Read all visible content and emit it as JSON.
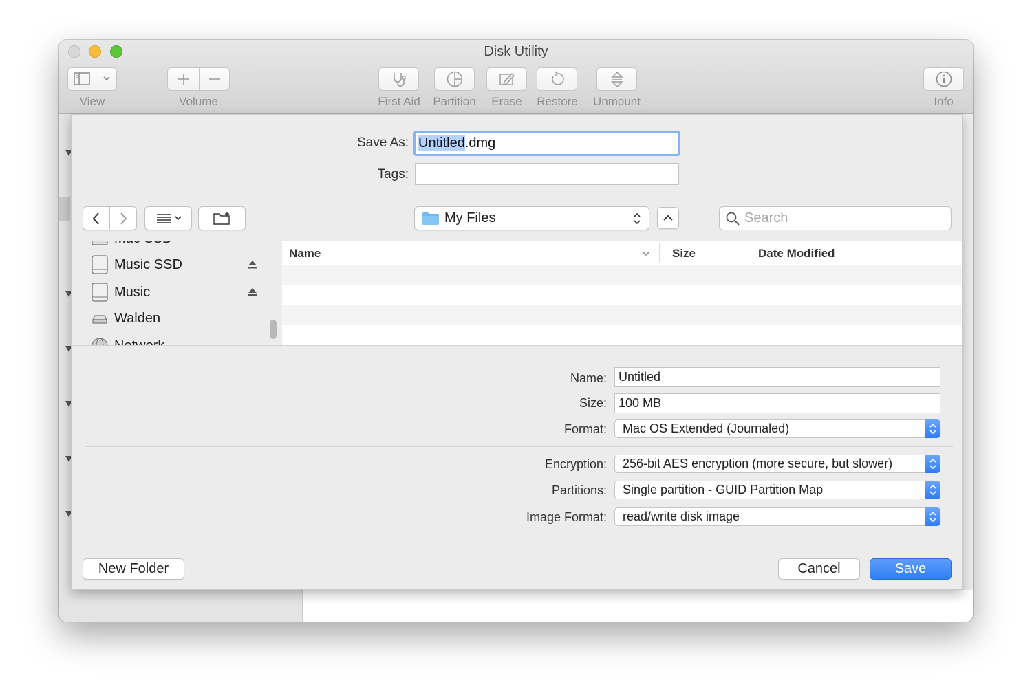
{
  "window": {
    "title": "Disk Utility"
  },
  "toolbar": {
    "view_label": "View",
    "volume_label": "Volume",
    "first_aid_label": "First Aid",
    "partition_label": "Partition",
    "erase_label": "Erase",
    "restore_label": "Restore",
    "unmount_label": "Unmount",
    "info_label": "Info"
  },
  "save_dialog": {
    "save_as_label": "Save As:",
    "save_as_selected": "Untitled",
    "save_as_suffix": ".dmg",
    "tags_label": "Tags:",
    "tags_value": "",
    "location": "My Files",
    "search_placeholder": "Search",
    "sidebar": {
      "items": [
        {
          "label": "Mac SSD",
          "icon": "internal-disk-icon",
          "eject": false
        },
        {
          "label": "Music SSD",
          "icon": "external-disk-icon",
          "eject": true
        },
        {
          "label": "Music",
          "icon": "external-disk-icon",
          "eject": true
        },
        {
          "label": "Walden",
          "icon": "server-disk-icon",
          "eject": false
        },
        {
          "label": "Network",
          "icon": "network-globe-icon",
          "eject": false
        }
      ]
    },
    "columns": {
      "name": "Name",
      "size": "Size",
      "date_modified": "Date Modified"
    },
    "options": {
      "name_label": "Name:",
      "name_value": "Untitled",
      "size_label": "Size:",
      "size_value": "100 MB",
      "format_label": "Format:",
      "format_value": "Mac OS Extended (Journaled)",
      "encryption_label": "Encryption:",
      "encryption_value": "256-bit AES encryption (more secure, but slower)",
      "partitions_label": "Partitions:",
      "partitions_value": "Single partition - GUID Partition Map",
      "image_format_label": "Image Format:",
      "image_format_value": "read/write disk image"
    },
    "buttons": {
      "new_folder": "New Folder",
      "cancel": "Cancel",
      "save": "Save"
    }
  },
  "colors": {
    "accent": "#2f7ff6",
    "selection": "#b3d2ff",
    "focus_ring": "#85b4f5",
    "folder": "#6cb8f0"
  }
}
